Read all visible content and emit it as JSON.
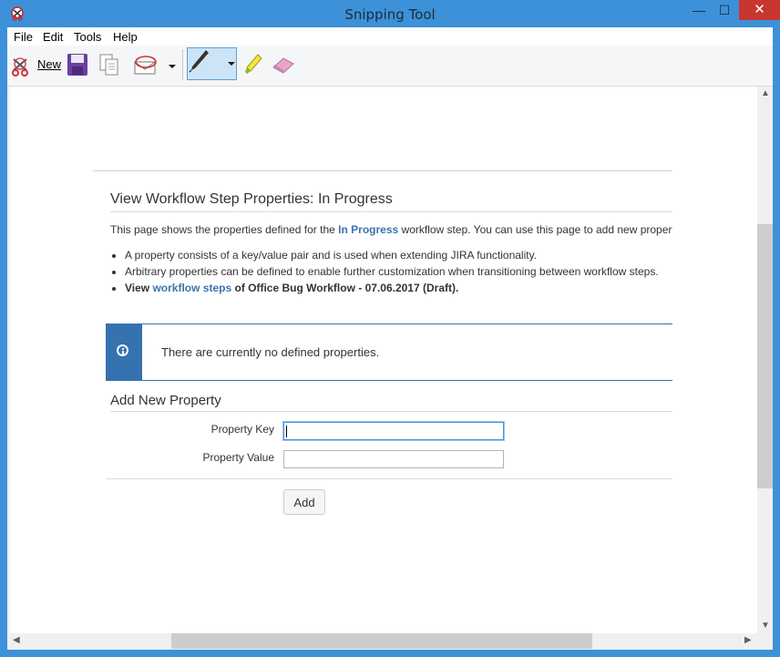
{
  "window": {
    "title": "Snipping Tool",
    "minimize": "—",
    "maximize": "☐",
    "close": "✕"
  },
  "menu": [
    "File",
    "Edit",
    "Tools",
    "Help"
  ],
  "toolbar": {
    "new_label": "New"
  },
  "page": {
    "title": "View Workflow Step Properties: In Progress",
    "desc_prefix": "This page shows the properties defined for the ",
    "desc_link": "In Progress",
    "desc_suffix": " workflow step. You can use this page to add new properties or delete existing ones.",
    "bullet1": "A property consists of a key/value pair and is used when extending JIRA functionality.",
    "bullet2": "Arbitrary properties can be defined to enable further customization when transitioning between workflow steps.",
    "bullet3_prefix": "View ",
    "bullet3_link": "workflow steps",
    "bullet3_suffix": " of Office Bug Workflow - 07.06.2017 (Draft).",
    "info_message": "There are currently no defined properties.",
    "section_title": "Add New Property",
    "key_label": "Property Key",
    "value_label": "Property Value",
    "key_value": "",
    "value_value": "",
    "add_button": "Add"
  },
  "colors": {
    "window_frame": "#3d91d8",
    "close_button": "#c7372f",
    "link": "#3b73af",
    "info_accent": "#3572b0"
  }
}
